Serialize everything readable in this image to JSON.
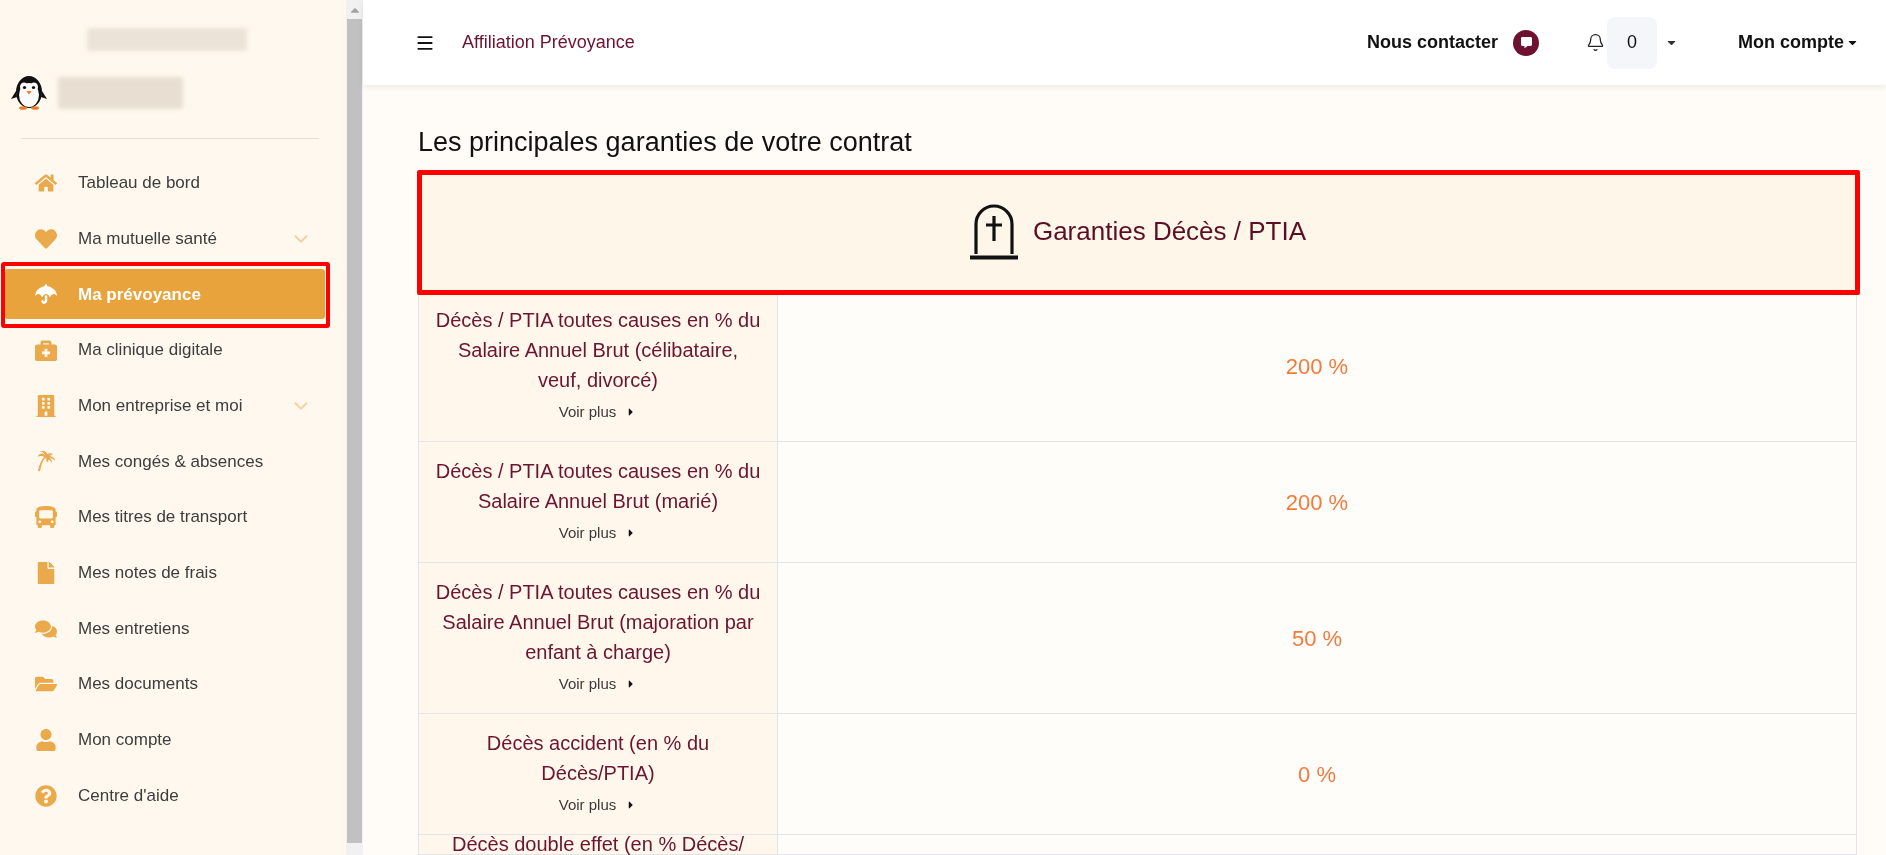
{
  "sidebar": {
    "items": [
      {
        "label": "Tableau de bord",
        "kind": "link",
        "selected": false,
        "highlighted": false
      },
      {
        "label": "Ma mutuelle santé",
        "kind": "menu",
        "selected": false,
        "highlighted": false
      },
      {
        "label": "Ma prévoyance",
        "kind": "link",
        "selected": true,
        "highlighted": true
      },
      {
        "label": "Ma clinique digitale",
        "kind": "link",
        "selected": false,
        "highlighted": false
      },
      {
        "label": "Mon entreprise et moi",
        "kind": "menu",
        "selected": false,
        "highlighted": false
      },
      {
        "label": "Mes congés & absences",
        "kind": "link",
        "selected": false,
        "highlighted": false
      },
      {
        "label": "Mes titres de transport",
        "kind": "link",
        "selected": false,
        "highlighted": false
      },
      {
        "label": "Mes notes de frais",
        "kind": "link",
        "selected": false,
        "highlighted": false
      },
      {
        "label": "Mes entretiens",
        "kind": "link",
        "selected": false,
        "highlighted": false
      },
      {
        "label": "Mes documents",
        "kind": "link",
        "selected": false,
        "highlighted": false
      },
      {
        "label": "Mon compte",
        "kind": "link",
        "selected": false,
        "highlighted": false
      },
      {
        "label": "Centre d'aide",
        "kind": "link",
        "selected": false,
        "highlighted": false
      }
    ]
  },
  "header": {
    "title": "Affiliation Prévoyance",
    "contact": "Nous contacter",
    "notification_count": "0",
    "account": "Mon compte"
  },
  "content": {
    "heading": "Les principales garanties de votre contrat",
    "section": {
      "title": "Garanties Décès / PTIA",
      "highlighted": true
    },
    "rows": [
      {
        "label": "Décès / PTIA toutes causes en % du Salaire Annuel Brut (célibataire, veuf, divorcé)",
        "link": "Voir plus",
        "value": "200 %"
      },
      {
        "label": "Décès / PTIA toutes causes en % du Salaire Annuel Brut (marié)",
        "link": "Voir plus",
        "value": "200 %"
      },
      {
        "label": "Décès / PTIA toutes causes en % du Salaire Annuel Brut (majoration par enfant à charge)",
        "link": "Voir plus",
        "value": "50 %"
      },
      {
        "label": "Décès accident (en % du Décès/PTIA)",
        "link": "Voir plus",
        "value": "0 %"
      },
      {
        "label": "Décès double effet (en % Décès/"
      }
    ]
  }
}
